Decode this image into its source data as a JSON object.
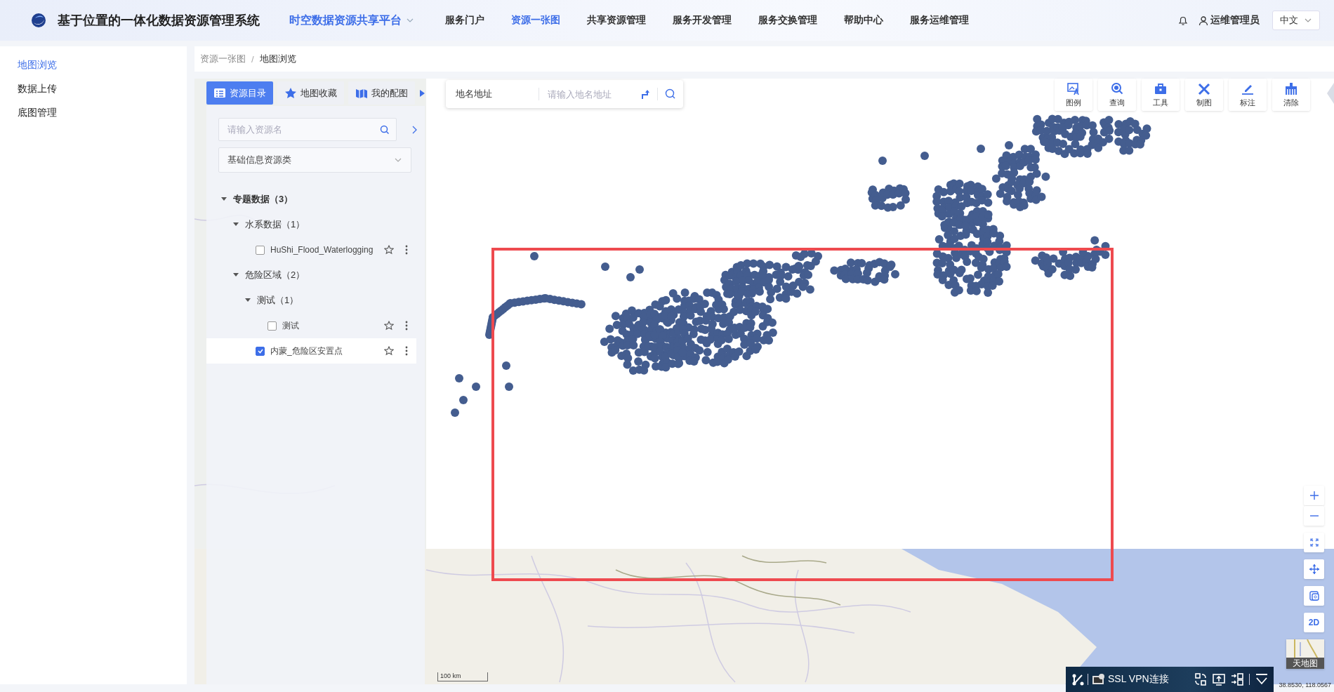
{
  "header": {
    "title": "基于位置的一体化数据资源管理系统",
    "platform": "时空数据资源共享平台",
    "nav": [
      {
        "label": "服务门户",
        "selected": false
      },
      {
        "label": "资源一张图",
        "selected": true
      },
      {
        "label": "共享资源管理",
        "selected": false
      },
      {
        "label": "服务开发管理",
        "selected": false
      },
      {
        "label": "服务交换管理",
        "selected": false
      },
      {
        "label": "帮助中心",
        "selected": false
      },
      {
        "label": "服务运维管理",
        "selected": false
      }
    ],
    "user": "运维管理员",
    "language": "中文"
  },
  "sidebar": {
    "items": [
      {
        "label": "地图浏览",
        "selected": true
      },
      {
        "label": "数据上传",
        "selected": false
      },
      {
        "label": "底图管理",
        "selected": false
      }
    ]
  },
  "breadcrumb": {
    "items": [
      "资源一张图",
      "地图浏览"
    ],
    "separator": "/"
  },
  "panel_tabs": [
    {
      "label": "资源目录",
      "selected": true,
      "kind": "catalog"
    },
    {
      "label": "地图收藏",
      "selected": false,
      "kind": "favorites"
    },
    {
      "label": "我的配图",
      "selected": false,
      "kind": "maps"
    }
  ],
  "place_search": {
    "type_label": "地名地址",
    "placeholder": "请输入地名地址"
  },
  "resource_search": {
    "placeholder": "请输入资源名"
  },
  "category_select": {
    "value": "基础信息资源类"
  },
  "tree": [
    {
      "label": "专题数据（3）",
      "expanded": true,
      "children": [
        {
          "label": "水系数据（1）",
          "expanded": true,
          "children": [
            {
              "label": "HuShi_Flood_Waterlogging",
              "checked": false,
              "selected": false
            }
          ]
        },
        {
          "label": "危险区域（2）",
          "expanded": true,
          "children": [
            {
              "label": "测试（1）",
              "expanded": true,
              "children": [
                {
                  "label": "测试",
                  "checked": false,
                  "selected": false
                }
              ]
            },
            {
              "label": "内蒙_危险区安置点",
              "checked": true,
              "selected": true
            }
          ]
        }
      ]
    }
  ],
  "toolbar": [
    {
      "label": "图例",
      "kind": "legend"
    },
    {
      "label": "查询",
      "kind": "query"
    },
    {
      "label": "工具",
      "kind": "tools"
    },
    {
      "label": "制图",
      "kind": "draw"
    },
    {
      "label": "标注",
      "kind": "mark"
    },
    {
      "label": "清除",
      "kind": "clear"
    }
  ],
  "map_controls": {
    "view_mode": "2D",
    "basemap": "天地图"
  },
  "scale": "100 km",
  "vpn_bar": {
    "label": "SSL VPN连接"
  },
  "coordinates": "38.8530, 118.0567"
}
